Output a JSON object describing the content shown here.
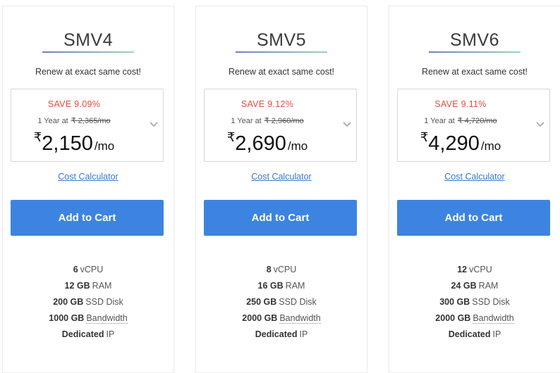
{
  "plans": [
    {
      "name": "SMV4",
      "renew": "Renew at exact same cost!",
      "save": "SAVE 9.09%",
      "term": "1 Year at",
      "original_price": "₹ 2,365/mo",
      "currency": "₹",
      "price": "2,150",
      "per": "/mo",
      "calculator": "Cost Calculator",
      "cta": "Add to Cart",
      "specs": {
        "cpu_value": "6",
        "cpu_label": "vCPU",
        "ram_value": "12 GB",
        "ram_label": "RAM",
        "disk_value": "200 GB",
        "disk_label": "SSD Disk",
        "bw_value": "1000 GB",
        "bw_label": "Bandwidth",
        "ip_value": "Dedicated",
        "ip_label": "IP"
      }
    },
    {
      "name": "SMV5",
      "renew": "Renew at exact same cost!",
      "save": "SAVE 9.12%",
      "term": "1 Year at",
      "original_price": "₹ 2,960/mo",
      "currency": "₹",
      "price": "2,690",
      "per": "/mo",
      "calculator": "Cost Calculator",
      "cta": "Add to Cart",
      "specs": {
        "cpu_value": "8",
        "cpu_label": "vCPU",
        "ram_value": "16 GB",
        "ram_label": "RAM",
        "disk_value": "250 GB",
        "disk_label": "SSD Disk",
        "bw_value": "2000 GB",
        "bw_label": "Bandwidth",
        "ip_value": "Dedicated",
        "ip_label": "IP"
      }
    },
    {
      "name": "SMV6",
      "renew": "Renew at exact same cost!",
      "save": "SAVE 9.11%",
      "term": "1 Year at",
      "original_price": "₹ 4,720/mo",
      "currency": "₹",
      "price": "4,290",
      "per": "/mo",
      "calculator": "Cost Calculator",
      "cta": "Add to Cart",
      "specs": {
        "cpu_value": "12",
        "cpu_label": "vCPU",
        "ram_value": "24 GB",
        "ram_label": "RAM",
        "disk_value": "300 GB",
        "disk_label": "SSD Disk",
        "bw_value": "2000 GB",
        "bw_label": "Bandwidth",
        "ip_value": "Dedicated",
        "ip_label": "IP"
      }
    }
  ],
  "colors": {
    "accent_button": "#3d84e0",
    "save_text": "#e84b3c",
    "link": "#3679c8"
  },
  "icons": {
    "dropdown": "chevron-down-icon"
  }
}
